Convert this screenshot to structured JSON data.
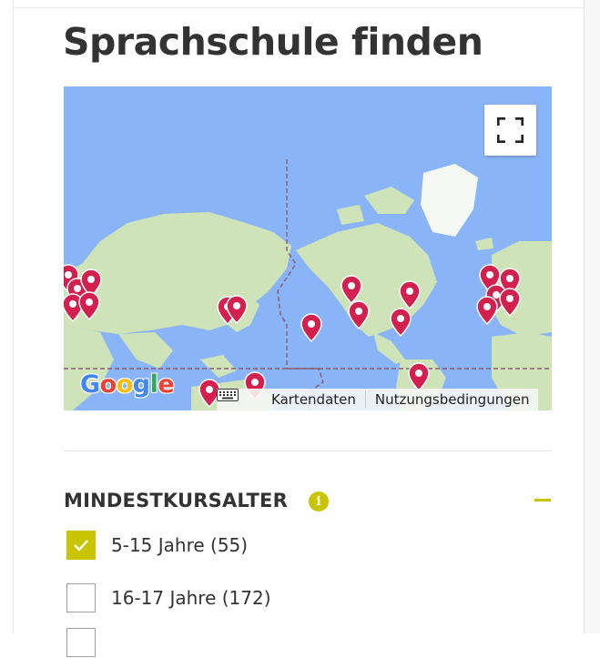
{
  "page": {
    "title": "Sprachschule finden"
  },
  "map": {
    "google_logo": [
      {
        "ch": "G",
        "color": "#4285F4"
      },
      {
        "ch": "o",
        "color": "#EA4335"
      },
      {
        "ch": "o",
        "color": "#FBBC05"
      },
      {
        "ch": "g",
        "color": "#4285F4"
      },
      {
        "ch": "l",
        "color": "#34A853"
      },
      {
        "ch": "e",
        "color": "#EA4335"
      }
    ],
    "map_data_link": "Kartendaten",
    "terms_link": "Nutzungsbedingungen",
    "pin_color": "#d4204f",
    "water_color": "#8ab4f8",
    "land_color": "#cfe3b8"
  },
  "filter": {
    "title": "MINDESTKURSALTER",
    "accent_color": "#c9c400",
    "options": [
      {
        "label": "5-15 Jahre (55)",
        "checked": true
      },
      {
        "label": "16-17 Jahre (172)",
        "checked": false
      }
    ]
  }
}
